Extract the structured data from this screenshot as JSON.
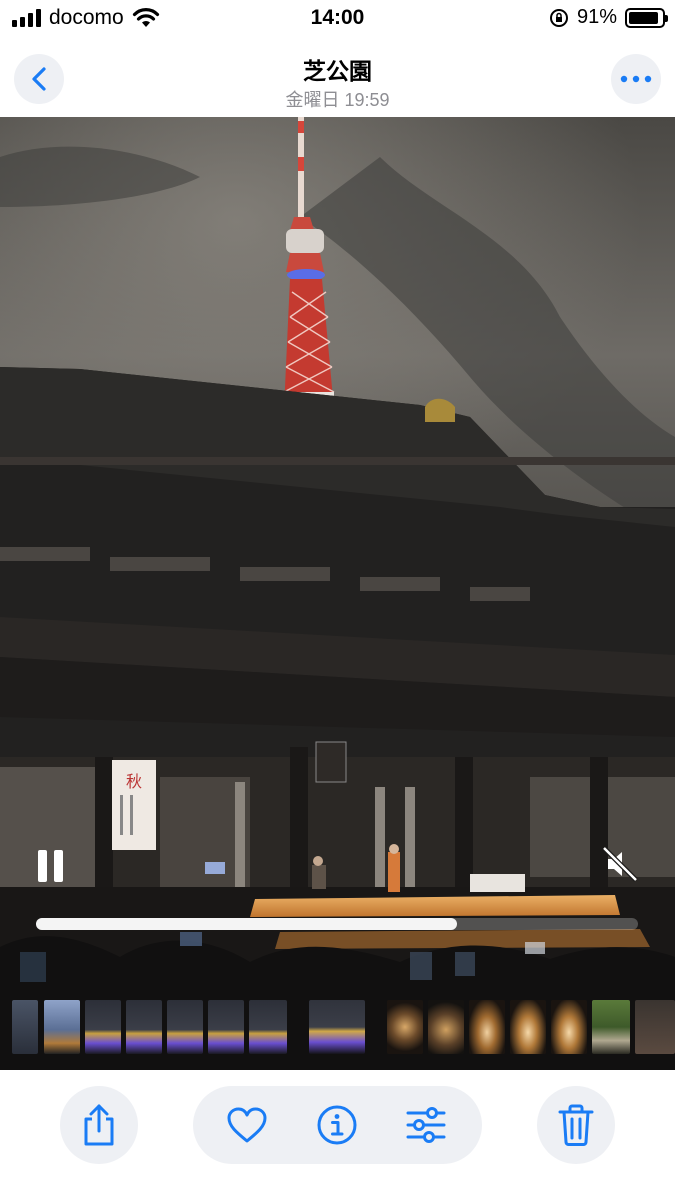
{
  "status_bar": {
    "carrier": "docomo",
    "time": "14:00",
    "battery": "91%",
    "battery_level": 0.91,
    "icons": [
      "signal-icon",
      "wifi-icon",
      "orientation-lock-icon",
      "battery-icon"
    ]
  },
  "header": {
    "title": "芝公園",
    "subtitle": "金曜日  19:59",
    "back_icon": "chevron-left-icon",
    "more_icon": "ellipsis-icon"
  },
  "video": {
    "state": "playing",
    "progress": 0.7,
    "muted": true,
    "pause_icon": "pause-icon",
    "mute_icon": "speaker-muted-icon"
  },
  "photo_text": {
    "banner_char": "秋"
  },
  "toolbar": {
    "icons": [
      "share-icon",
      "heart-icon",
      "info-icon",
      "adjust-icon",
      "trash-icon"
    ]
  },
  "colors": {
    "accent": "#1a7cf5",
    "button_bg": "#eef0f4",
    "subtitle": "#8e8e93"
  }
}
